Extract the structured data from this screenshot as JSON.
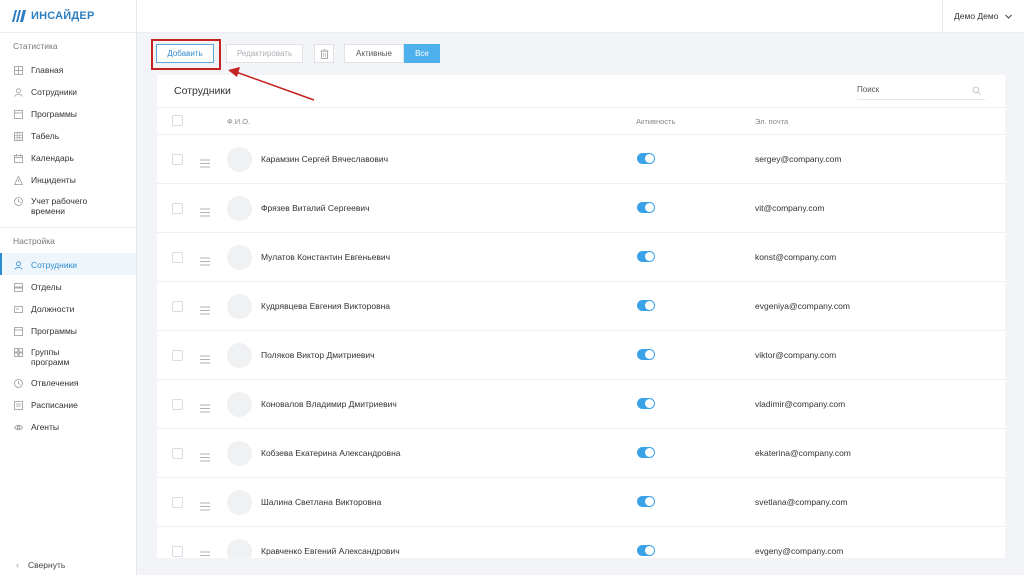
{
  "app": {
    "name": "ИНСАЙДЕР"
  },
  "user": {
    "name": "Демо Демо"
  },
  "sidebar": {
    "stats_title": "Статистика",
    "stats_items": [
      {
        "label": "Главная",
        "icon": "dashboard-icon"
      },
      {
        "label": "Сотрудники",
        "icon": "user-icon"
      },
      {
        "label": "Программы",
        "icon": "programs-icon"
      },
      {
        "label": "Табель",
        "icon": "table-icon"
      },
      {
        "label": "Календарь",
        "icon": "calendar-icon"
      },
      {
        "label": "Инциденты",
        "icon": "warning-icon"
      },
      {
        "label": "Учет рабочего времени",
        "icon": "clock-icon"
      }
    ],
    "settings_title": "Настройка",
    "settings_items": [
      {
        "label": "Сотрудники",
        "icon": "user-icon",
        "active": true
      },
      {
        "label": "Отделы",
        "icon": "departments-icon"
      },
      {
        "label": "Должности",
        "icon": "id-card-icon"
      },
      {
        "label": "Программы",
        "icon": "programs-icon"
      },
      {
        "label": "Группы программ",
        "icon": "grid-icon"
      },
      {
        "label": "Отвлечения",
        "icon": "clock-icon"
      },
      {
        "label": "Расписание",
        "icon": "schedule-icon"
      },
      {
        "label": "Агенты",
        "icon": "eye-icon"
      }
    ],
    "collapse_label": "Свернуть"
  },
  "toolbar": {
    "add_label": "Добавить",
    "edit_label": "Редактировать",
    "filter_active_label": "Активные",
    "filter_all_label": "Все",
    "selected_filter": "Все"
  },
  "panel": {
    "title": "Сотрудники",
    "search_placeholder": "Поиск",
    "columns": {
      "name": "Ф.И.О.",
      "activity": "Активность",
      "email": "Эл. почта"
    }
  },
  "employees": [
    {
      "name": "Карамзин Сергей Вячеславович",
      "active": true,
      "email": "sergey@company.com"
    },
    {
      "name": "Фрязев Виталий Сергеевич",
      "active": true,
      "email": "vit@company.com"
    },
    {
      "name": "Мулатов Константин Евгеньевич",
      "active": true,
      "email": "konst@company.com"
    },
    {
      "name": "Кудрявцева Евгения Викторовна",
      "active": true,
      "email": "evgeniya@company.com"
    },
    {
      "name": "Поляков Виктор Дмитриевич",
      "active": true,
      "email": "viktor@company.com"
    },
    {
      "name": "Коновалов Владимир Дмитриевич",
      "active": true,
      "email": "vladimir@company.com"
    },
    {
      "name": "Кобзева Екатерина Александровна",
      "active": true,
      "email": "ekaterina@company.com"
    },
    {
      "name": "Шалина Светлана Викторовна",
      "active": true,
      "email": "svetlana@company.com"
    },
    {
      "name": "Кравченко Евгений Александрович",
      "active": true,
      "email": "evgeny@company.com"
    }
  ],
  "colors": {
    "accent": "#2e8bd0",
    "toggle_on": "#3aa3e8",
    "annotation": "#c52323",
    "logo": "#2d7fc1"
  }
}
